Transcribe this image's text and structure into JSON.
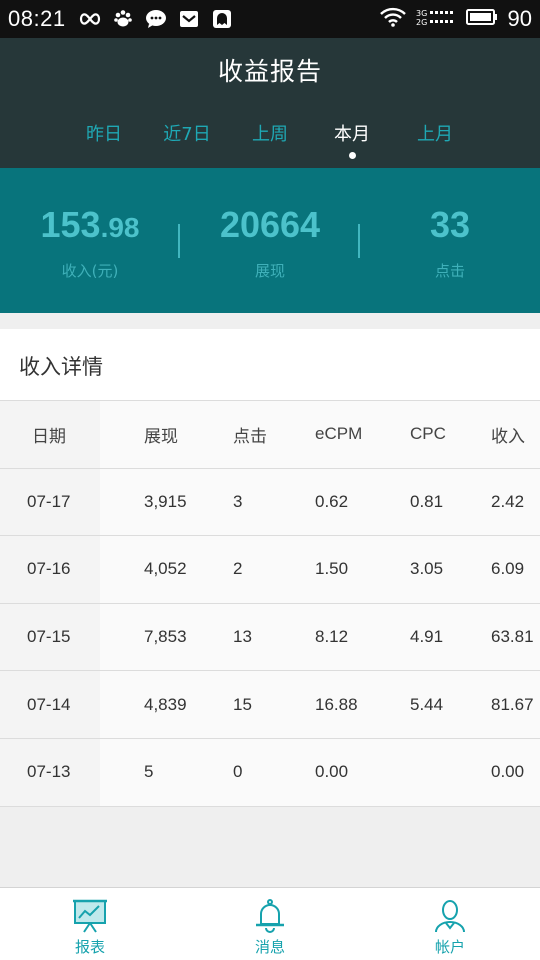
{
  "status_bar": {
    "time": "08:21",
    "battery": "90",
    "left_icons": [
      "infinity-icon",
      "paw-icon",
      "chat-icon",
      "mail-icon",
      "ghost-icon"
    ],
    "right_icons": [
      "wifi-icon",
      "signal-icon",
      "battery-icon"
    ]
  },
  "header": {
    "title": "收益报告",
    "tabs": [
      {
        "label": "昨日",
        "active": false
      },
      {
        "label": "近7日",
        "active": false
      },
      {
        "label": "上周",
        "active": false
      },
      {
        "label": "本月",
        "active": true
      },
      {
        "label": "上月",
        "active": false
      }
    ]
  },
  "summary": {
    "income": {
      "int": "153",
      "dec": ".98",
      "label": "收入(元)"
    },
    "impressions": {
      "value": "20664",
      "label": "展现"
    },
    "clicks": {
      "value": "33",
      "label": "点击"
    }
  },
  "detail": {
    "title": "收入详情",
    "columns": [
      "日期",
      "展现",
      "点击",
      "eCPM",
      "CPC",
      "收入"
    ],
    "rows": [
      [
        "07-17",
        "3,915",
        "3",
        "0.62",
        "0.81",
        "2.42"
      ],
      [
        "07-16",
        "4,052",
        "2",
        "1.50",
        "3.05",
        "6.09"
      ],
      [
        "07-15",
        "7,853",
        "13",
        "8.12",
        "4.91",
        "63.81"
      ],
      [
        "07-14",
        "4,839",
        "15",
        "16.88",
        "5.44",
        "81.67"
      ],
      [
        "07-13",
        "5",
        "0",
        "0.00",
        "",
        "0.00"
      ]
    ]
  },
  "nav": {
    "items": [
      {
        "label": "报表",
        "icon": "report-icon"
      },
      {
        "label": "消息",
        "icon": "bell-icon"
      },
      {
        "label": "帐户",
        "icon": "account-icon"
      }
    ]
  },
  "colors": {
    "header_bg": "#263739",
    "summary_bg": "#08747c",
    "accent": "#16a2ad",
    "stat_value": "#4cc2cb"
  }
}
